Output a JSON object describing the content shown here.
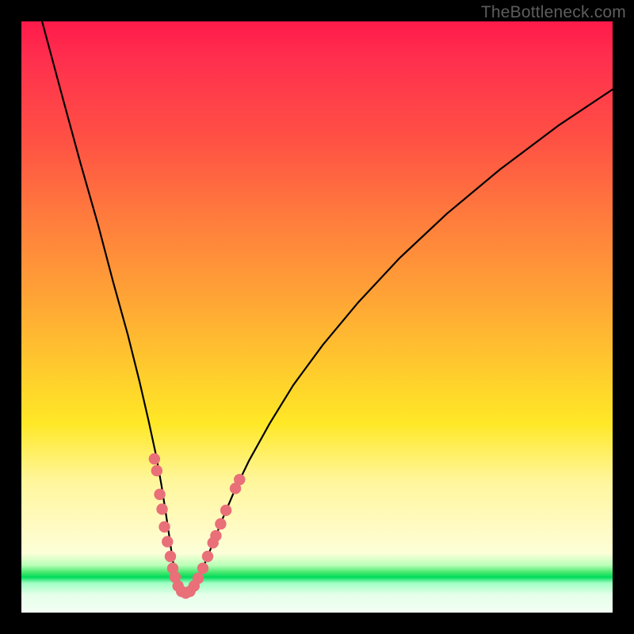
{
  "watermark": "TheBottleneck.com",
  "colors": {
    "frame": "#000000",
    "curve": "#000000",
    "marker_fill": "#e96f78",
    "marker_stroke": "#d85e67"
  },
  "chart_data": {
    "type": "line",
    "title": "",
    "xlabel": "",
    "ylabel": "",
    "xlim": [
      0,
      100
    ],
    "ylim": [
      0,
      100
    ],
    "curve_xy": [
      [
        3.5,
        100.0
      ],
      [
        7.0,
        87.0
      ],
      [
        10.0,
        76.0
      ],
      [
        13.0,
        65.5
      ],
      [
        15.5,
        56.0
      ],
      [
        18.0,
        47.0
      ],
      [
        20.0,
        39.0
      ],
      [
        21.5,
        32.5
      ],
      [
        22.8,
        26.5
      ],
      [
        23.7,
        21.5
      ],
      [
        24.4,
        17.0
      ],
      [
        25.0,
        13.0
      ],
      [
        25.5,
        9.5
      ],
      [
        25.9,
        7.0
      ],
      [
        26.3,
        5.3
      ],
      [
        26.7,
        4.1
      ],
      [
        27.1,
        3.4
      ],
      [
        27.6,
        3.1
      ],
      [
        28.1,
        3.2
      ],
      [
        28.7,
        3.7
      ],
      [
        29.4,
        4.8
      ],
      [
        30.3,
        6.6
      ],
      [
        31.3,
        9.0
      ],
      [
        32.5,
        12.0
      ],
      [
        34.0,
        15.8
      ],
      [
        36.0,
        20.5
      ],
      [
        38.5,
        25.7
      ],
      [
        42.0,
        32.0
      ],
      [
        46.0,
        38.5
      ],
      [
        51.0,
        45.3
      ],
      [
        57.0,
        52.5
      ],
      [
        64.0,
        60.0
      ],
      [
        72.0,
        67.5
      ],
      [
        81.0,
        75.0
      ],
      [
        91.0,
        82.5
      ],
      [
        100.0,
        88.5
      ]
    ],
    "series": [
      {
        "name": "markers",
        "points_xy": [
          [
            22.5,
            26.0
          ],
          [
            22.9,
            24.0
          ],
          [
            23.4,
            20.0
          ],
          [
            23.8,
            17.5
          ],
          [
            24.2,
            14.5
          ],
          [
            24.7,
            12.0
          ],
          [
            25.2,
            9.5
          ],
          [
            25.6,
            7.5
          ],
          [
            26.0,
            6.0
          ],
          [
            26.5,
            4.5
          ],
          [
            27.1,
            3.6
          ],
          [
            27.8,
            3.3
          ],
          [
            28.5,
            3.6
          ],
          [
            29.2,
            4.5
          ],
          [
            29.9,
            5.8
          ],
          [
            30.7,
            7.5
          ],
          [
            31.5,
            9.5
          ],
          [
            32.4,
            11.8
          ],
          [
            32.9,
            13.0
          ],
          [
            33.7,
            15.0
          ],
          [
            34.6,
            17.3
          ],
          [
            36.2,
            21.0
          ],
          [
            36.9,
            22.5
          ]
        ]
      }
    ]
  }
}
